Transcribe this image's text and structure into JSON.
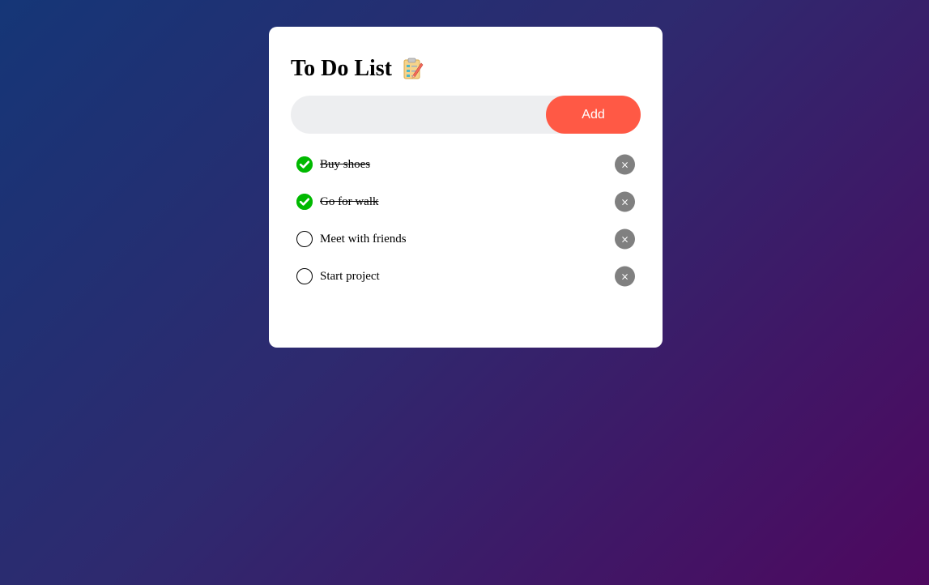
{
  "app": {
    "title": "To Do List",
    "title_icon": "clipboard-checklist-icon"
  },
  "input": {
    "value": "",
    "placeholder": "",
    "add_label": "Add"
  },
  "colors": {
    "background_start": "#153677",
    "background_end": "#4e085f",
    "add_button": "#ff5945",
    "checked": "#00b900",
    "delete_button": "#808080"
  },
  "tasks": [
    {
      "label": "Buy shoes",
      "done": true,
      "delete_label": "×"
    },
    {
      "label": "Go for walk",
      "done": true,
      "delete_label": "×"
    },
    {
      "label": "Meet with friends",
      "done": false,
      "delete_label": "×"
    },
    {
      "label": "Start project",
      "done": false,
      "delete_label": "×"
    }
  ]
}
